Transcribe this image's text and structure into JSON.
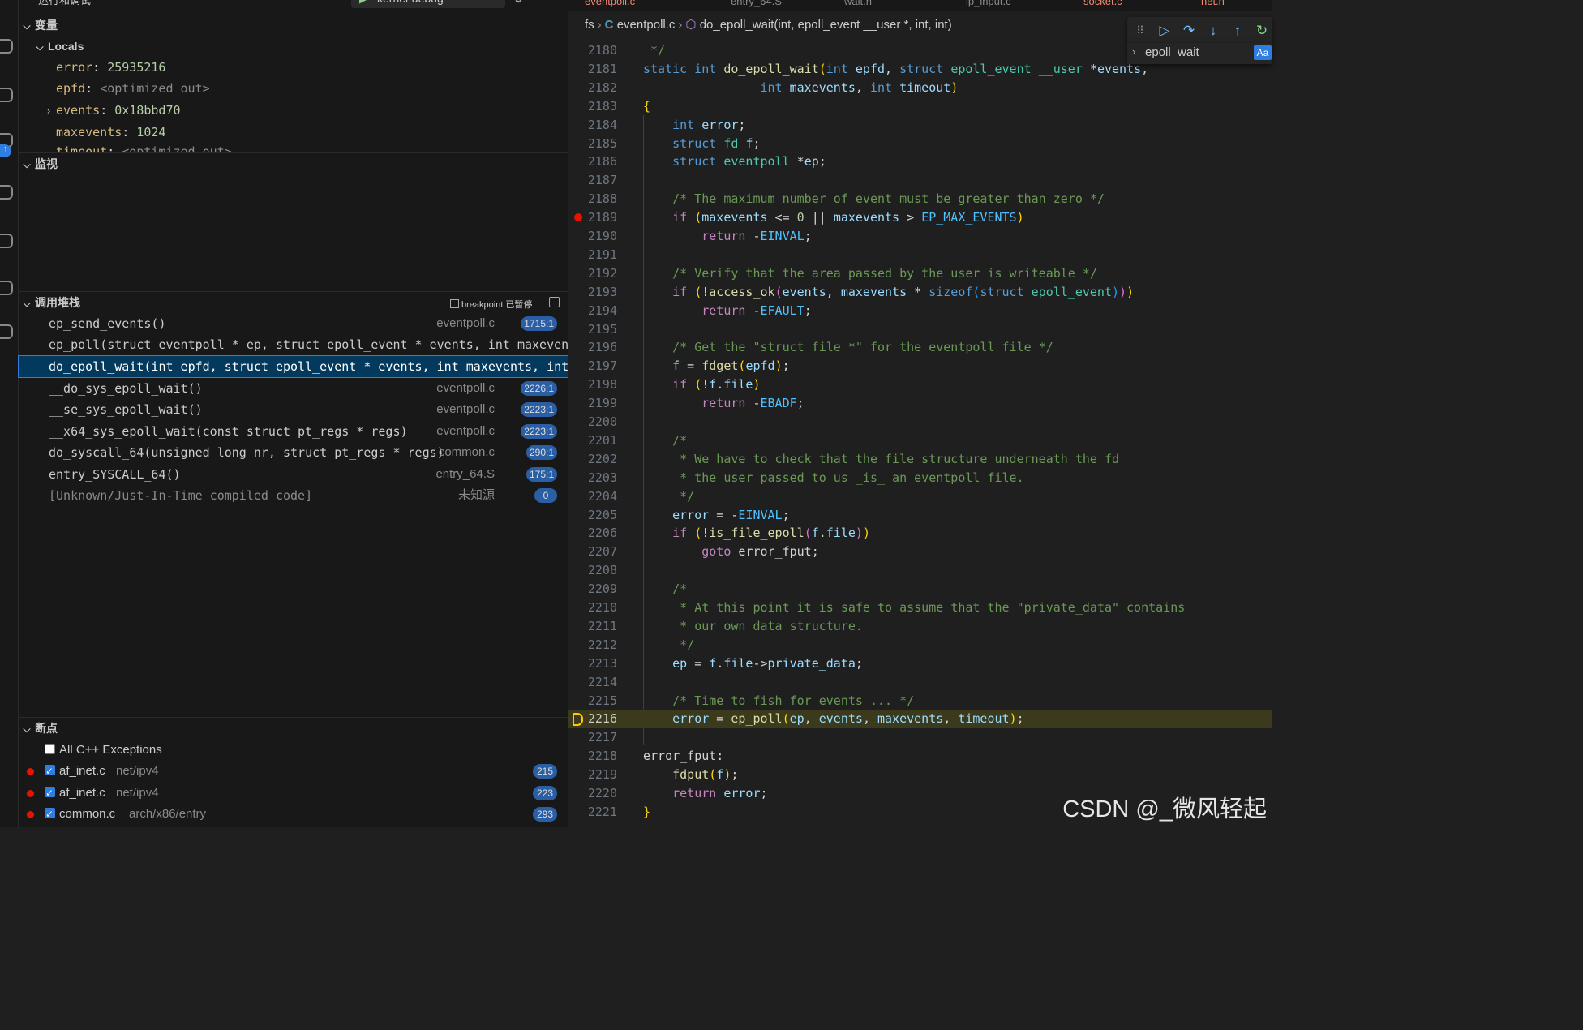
{
  "activity_bar": {
    "debug_badge": "1"
  },
  "sidebar": {
    "top_cut_left": "运行和调试",
    "top_cut_config": "kernel-debug",
    "variables": {
      "title": "变量",
      "locals_label": "Locals",
      "items": [
        {
          "name": "error",
          "value": "25935216"
        },
        {
          "name": "epfd",
          "value": "<optimized out>"
        },
        {
          "name": "events",
          "value": "0x18bbd70"
        },
        {
          "name": "maxevents",
          "value": "1024"
        },
        {
          "name": "timeout",
          "value": "<optimized out>"
        }
      ]
    },
    "watch": {
      "title": "监视"
    },
    "call_stack": {
      "title": "调用堆栈",
      "status": "breakpoint 已暂停",
      "frames": [
        {
          "name": "ep_send_events()",
          "file": "eventpoll.c",
          "line": "1715:1"
        },
        {
          "name": "ep_poll(struct eventpoll * ep, struct epoll_event * events, int maxevents,",
          "file": "",
          "line": ""
        },
        {
          "name": "do_epoll_wait(int epfd, struct epoll_event * events, int maxevents, int timeout)",
          "file": "",
          "line": ""
        },
        {
          "name": "__do_sys_epoll_wait()",
          "file": "eventpoll.c",
          "line": "2226:1"
        },
        {
          "name": "__se_sys_epoll_wait()",
          "file": "eventpoll.c",
          "line": "2223:1"
        },
        {
          "name": "__x64_sys_epoll_wait(const struct pt_regs * regs)",
          "file": "eventpoll.c",
          "line": "2223:1"
        },
        {
          "name": "do_syscall_64(unsigned long nr, struct pt_regs * regs)",
          "file": "common.c",
          "line": "290:1"
        },
        {
          "name": "entry_SYSCALL_64()",
          "file": "entry_64.S",
          "line": "175:1"
        },
        {
          "name": "[Unknown/Just-In-Time compiled code]",
          "file": "未知源",
          "line": "0"
        }
      ]
    },
    "breakpoints": {
      "title": "断点",
      "items": [
        {
          "file": "All C++ Exceptions",
          "path": "",
          "count": "",
          "checked": false,
          "dot": false
        },
        {
          "file": "af_inet.c",
          "path": "net/ipv4",
          "count": "215",
          "checked": true,
          "dot": true
        },
        {
          "file": "af_inet.c",
          "path": "net/ipv4",
          "count": "223",
          "checked": true,
          "dot": true
        },
        {
          "file": "common.c",
          "path": "arch/x86/entry",
          "count": "293",
          "checked": true,
          "dot": true
        }
      ]
    }
  },
  "editor": {
    "tabs": [
      "eventpoll.c",
      "entry_64.S",
      "wait.h",
      "ip_input.c",
      "socket.c",
      "net.h"
    ],
    "breadcrumb": {
      "folder": "fs",
      "lang": "C",
      "file": "eventpoll.c",
      "symbol": "do_epoll_wait(int, epoll_event __user *, int, int)"
    },
    "find": {
      "query": "epoll_wait",
      "match_case": "Aa"
    },
    "current_line": "2216",
    "breakpoint_line": "2189",
    "lines": [
      {
        "n": "2180",
        "t": " */"
      },
      {
        "n": "2181",
        "t": "static int do_epoll_wait(int epfd, struct epoll_event __user *events,"
      },
      {
        "n": "2182",
        "t": "                int maxevents, int timeout)"
      },
      {
        "n": "2183",
        "t": "{"
      },
      {
        "n": "2184",
        "t": "    int error;"
      },
      {
        "n": "2185",
        "t": "    struct fd f;"
      },
      {
        "n": "2186",
        "t": "    struct eventpoll *ep;"
      },
      {
        "n": "2187",
        "t": ""
      },
      {
        "n": "2188",
        "t": "    /* The maximum number of event must be greater than zero */"
      },
      {
        "n": "2189",
        "t": "    if (maxevents <= 0 || maxevents > EP_MAX_EVENTS)"
      },
      {
        "n": "2190",
        "t": "        return -EINVAL;"
      },
      {
        "n": "2191",
        "t": ""
      },
      {
        "n": "2192",
        "t": "    /* Verify that the area passed by the user is writeable */"
      },
      {
        "n": "2193",
        "t": "    if (!access_ok(events, maxevents * sizeof(struct epoll_event)))"
      },
      {
        "n": "2194",
        "t": "        return -EFAULT;"
      },
      {
        "n": "2195",
        "t": ""
      },
      {
        "n": "2196",
        "t": "    /* Get the \"struct file *\" for the eventpoll file */"
      },
      {
        "n": "2197",
        "t": "    f = fdget(epfd);"
      },
      {
        "n": "2198",
        "t": "    if (!f.file)"
      },
      {
        "n": "2199",
        "t": "        return -EBADF;"
      },
      {
        "n": "2200",
        "t": ""
      },
      {
        "n": "2201",
        "t": "    /*"
      },
      {
        "n": "2202",
        "t": "     * We have to check that the file structure underneath the fd"
      },
      {
        "n": "2203",
        "t": "     * the user passed to us _is_ an eventpoll file."
      },
      {
        "n": "2204",
        "t": "     */"
      },
      {
        "n": "2205",
        "t": "    error = -EINVAL;"
      },
      {
        "n": "2206",
        "t": "    if (!is_file_epoll(f.file))"
      },
      {
        "n": "2207",
        "t": "        goto error_fput;"
      },
      {
        "n": "2208",
        "t": ""
      },
      {
        "n": "2209",
        "t": "    /*"
      },
      {
        "n": "2210",
        "t": "     * At this point it is safe to assume that the \"private_data\" contains"
      },
      {
        "n": "2211",
        "t": "     * our own data structure."
      },
      {
        "n": "2212",
        "t": "     */"
      },
      {
        "n": "2213",
        "t": "    ep = f.file->private_data;"
      },
      {
        "n": "2214",
        "t": ""
      },
      {
        "n": "2215",
        "t": "    /* Time to fish for events ... */"
      },
      {
        "n": "2216",
        "t": "    error = ep_poll(ep, events, maxevents, timeout);"
      },
      {
        "n": "2217",
        "t": ""
      },
      {
        "n": "2218",
        "t": "error_fput:"
      },
      {
        "n": "2219",
        "t": "    fdput(f);"
      },
      {
        "n": "2220",
        "t": "    return error;"
      },
      {
        "n": "2221",
        "t": "}"
      }
    ]
  },
  "watermark": "CSDN @_微风轻起",
  "colors": {
    "breakpoint": "#e51400",
    "current_line_bg": "#3b3a1c",
    "accent": "#2f7de1"
  }
}
